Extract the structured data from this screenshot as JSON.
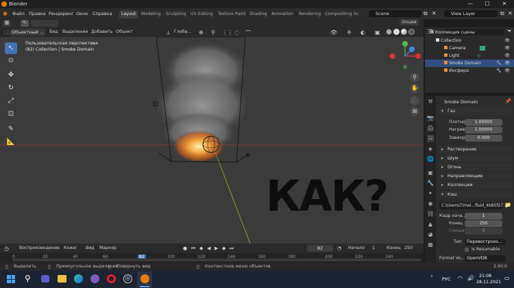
{
  "window": {
    "title": "Blender",
    "minimize": "—",
    "maximize": "☐",
    "close": "✕"
  },
  "menu": {
    "items": [
      "Файл",
      "Правка",
      "Рендеринг",
      "Окно",
      "Справка"
    ],
    "tabs": [
      "Layout",
      "Modeling",
      "Sculpting",
      "UV Editing",
      "Texture Paint",
      "Shading",
      "Animation",
      "Rendering",
      "Compositing",
      "Sc"
    ],
    "scene": "Scene",
    "view_layer": "View Layer"
  },
  "vp_header": {
    "mode": "Объектный ...",
    "view": "Вид",
    "select": "Выделение",
    "add": "Добавить",
    "object": "Объект",
    "orientation": "Глоба...",
    "options": "Опции"
  },
  "viewport": {
    "overlay_line1": "Пользовательская перспектива",
    "overlay_line2": "(82) Collection | Smoke Domain",
    "big_text": "КАК?"
  },
  "outliner": {
    "search": "",
    "rows": [
      "Коллекция сцены",
      "Collection",
      "Camera",
      "Light",
      "Smoke Domain",
      "Инсфера"
    ]
  },
  "properties": {
    "object_name": "Smoke Domain",
    "gas": "Газ",
    "density_label": "Плотност...",
    "density": "1.00000",
    "heat_label": "Нагрев",
    "heat": "1.00000",
    "vorticity_label": "Завихрён...",
    "vorticity": "0.000",
    "panels": [
      "Растворение",
      "Шум",
      "Огонь",
      "Направляющие",
      "Коллекции",
      "Кэш"
    ],
    "cache_path": "C:\\Users\\Timal...fluid_4b85f272",
    "frame_start_label": "Кадр нача...",
    "frame_start": "1",
    "end_label": "Конец",
    "end": "250",
    "offset_label": "Смещение",
    "offset": "0",
    "type_label": "Тип",
    "type": "Перевостроиз...",
    "resumable": "Is Resumable",
    "format_label": "Format Vo...",
    "format": "OpenVDB"
  },
  "timeline": {
    "playback": "Воспроизведение",
    "keying": "Кеинг",
    "view": "Вид",
    "marker": "Маркер",
    "current": "82",
    "start_label": "Начало",
    "start": "1",
    "end_label": "Конец",
    "end": "250",
    "ticks": [
      "0",
      "20",
      "40",
      "60",
      "82",
      "100",
      "120",
      "140",
      "160",
      "180",
      "200",
      "220",
      "240"
    ]
  },
  "status": {
    "select": "Выделить",
    "box_select": "Прямоугольное выделение",
    "rotate": "Повернуть вид",
    "context": "Контекстное меню объектов",
    "version": "2.90.0"
  },
  "taskbar": {
    "lang": "РУС",
    "time": "21:08",
    "date": "28.11.2021"
  }
}
